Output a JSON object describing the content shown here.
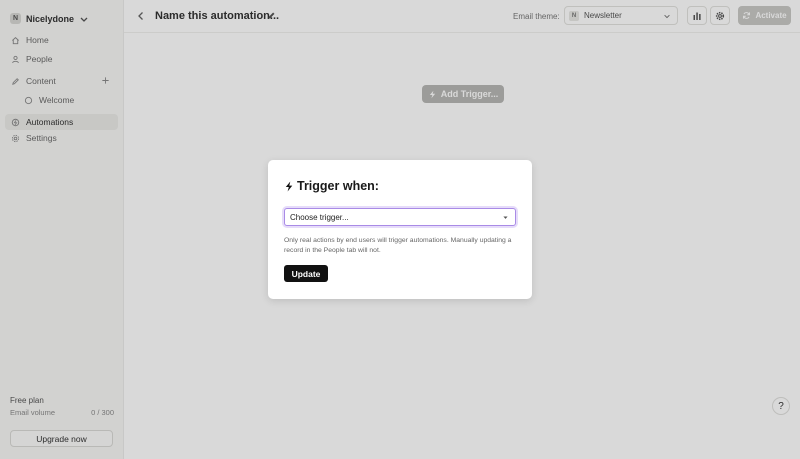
{
  "workspace": {
    "initial": "N",
    "name": "Nicelydone"
  },
  "sidebar": {
    "items": [
      {
        "label": "Home",
        "icon": "home-icon"
      },
      {
        "label": "People",
        "icon": "person-icon"
      },
      {
        "label": "Content",
        "icon": "pen-icon"
      },
      {
        "label": "Welcome",
        "icon": "document-icon"
      },
      {
        "label": "Automations",
        "icon": "automation-icon"
      },
      {
        "label": "Settings",
        "icon": "gear-icon"
      }
    ]
  },
  "plan": {
    "title": "Free plan",
    "emails_label": "Email volume",
    "emails_value": "0 / 300",
    "upgrade_label": "Upgrade now"
  },
  "header": {
    "title": "Name this automation...",
    "email_theme_label": "Email theme:",
    "email_theme_badge": "N",
    "email_theme_value": "Newsletter",
    "activate_label": "Activate"
  },
  "canvas": {
    "add_trigger_label": "Add Trigger..."
  },
  "modal": {
    "title": "Trigger when:",
    "select_value": "Choose trigger...",
    "help_text": "Only real actions by end users will trigger automations. Manually updating a record in the People tab will not.",
    "update_label": "Update"
  },
  "help_button": {
    "label": "?"
  },
  "colors": {
    "accent_focus": "#a98be6",
    "primary_button": "#111111",
    "sidebar_bg": "#f7f7f5"
  }
}
